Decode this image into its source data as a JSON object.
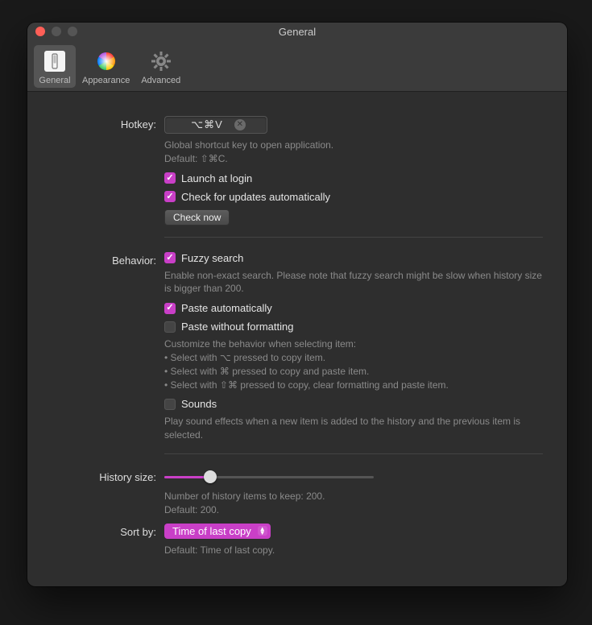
{
  "window": {
    "title": "General"
  },
  "toolbar": {
    "items": [
      {
        "label": "General"
      },
      {
        "label": "Appearance"
      },
      {
        "label": "Advanced"
      }
    ]
  },
  "hotkey": {
    "label": "Hotkey:",
    "value": "⌥⌘V",
    "help_line1": "Global shortcut key to open application.",
    "help_line2": "Default: ⇧⌘C."
  },
  "launch": {
    "label": "Launch at login"
  },
  "updates": {
    "label": "Check for updates automatically"
  },
  "check_now": {
    "label": "Check now"
  },
  "behavior": {
    "label": "Behavior:",
    "fuzzy_label": "Fuzzy search",
    "fuzzy_help": "Enable non-exact search. Please note that fuzzy search might be slow when history size is bigger than 200.",
    "paste_auto_label": "Paste automatically",
    "paste_plain_label": "Paste without formatting",
    "customize_intro": "Customize the behavior when selecting item:",
    "bullet1": "• Select with ⌥ pressed to copy item.",
    "bullet2": "• Select with ⌘ pressed to copy and paste item.",
    "bullet3": "• Select with ⇧⌘ pressed to copy, clear formatting and paste item.",
    "sounds_label": "Sounds",
    "sounds_help": "Play sound effects when a new item is added to the history and the previous item is selected."
  },
  "history": {
    "label": "History size:",
    "help_line1": "Number of history items to keep: 200.",
    "help_line2": "Default: 200."
  },
  "sort": {
    "label": "Sort by:",
    "value": "Time of last copy",
    "help": "Default: Time of last copy."
  }
}
